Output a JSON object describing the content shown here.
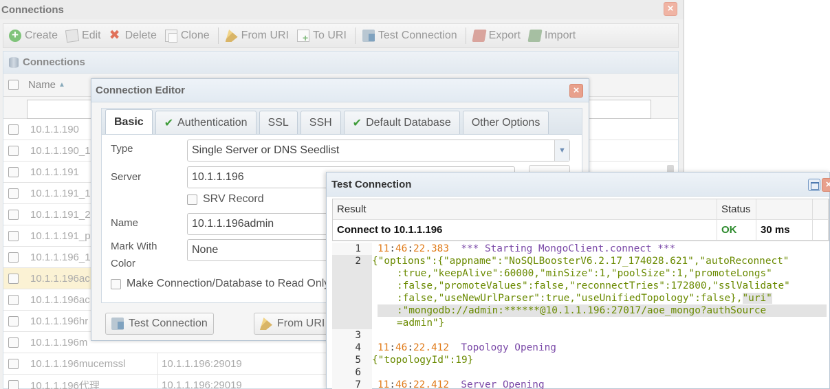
{
  "main_window": {
    "title": "Connections",
    "toolbar": {
      "create": "Create",
      "edit": "Edit",
      "delete": "Delete",
      "clone": "Clone",
      "from_uri": "From URI",
      "to_uri": "To URI",
      "test_connection": "Test Connection",
      "export": "Export",
      "import": "Import"
    },
    "panel_title": "Connections",
    "columns": {
      "name": "Name"
    },
    "rows": [
      {
        "name": "10.1.1.190",
        "server": ""
      },
      {
        "name": "10.1.1.190_1",
        "server": ""
      },
      {
        "name": "10.1.1.191",
        "server": ""
      },
      {
        "name": "10.1.1.191_1",
        "server": ""
      },
      {
        "name": "10.1.1.191_2",
        "server": ""
      },
      {
        "name": "10.1.1.191_p",
        "server": ""
      },
      {
        "name": "10.1.1.196_1",
        "server": ""
      },
      {
        "name": "10.1.1.196ac",
        "server": ""
      },
      {
        "name": "10.1.1.196ac",
        "server": ""
      },
      {
        "name": "10.1.1.196hr",
        "server": ""
      },
      {
        "name": "10.1.1.196m",
        "server": ""
      },
      {
        "name": "10.1.1.196mucemssl",
        "server": "10.1.1.196:29019"
      },
      {
        "name": "10.1.1.196代理",
        "server": "10.1.1.196:29019"
      }
    ]
  },
  "editor": {
    "title": "Connection Editor",
    "tabs": [
      "Basic",
      "Authentication",
      "SSL",
      "SSH",
      "Default Database",
      "Other Options"
    ],
    "type_label": "Type",
    "type_value": "Single Server or DNS Seedlist",
    "server_label": "Server",
    "server_value": "10.1.1.196",
    "srv_record": "SRV Record",
    "name_label": "Name",
    "name_value": "10.1.1.196admin",
    "mark_label_1": "Mark With",
    "mark_label_2": "Color",
    "mark_value": "None",
    "read_only": "Make Connection/Database to Read Only",
    "test_btn": "Test Connection",
    "from_uri_btn": "From URI"
  },
  "test_dialog": {
    "title": "Test Connection",
    "headers": {
      "result": "Result",
      "status": "Status"
    },
    "result": {
      "text": "Connect to 10.1.1.196",
      "status": "OK",
      "time": "30 ms"
    },
    "log": {
      "line1": {
        "time_h": "11",
        "time_m": "46",
        "time_s": "22.383",
        "msg": "*** Starting MongoClient.connect ***"
      },
      "line2_a": "{\"options\":{\"appname\":\"NoSQLBoosterV6.2.17_174028.621\",\"autoReconnect\"",
      "line2_b": ":true,\"keepAlive\":60000,\"minSize\":1,\"poolSize\":1,\"promoteLongs\"",
      "line2_c": ":false,\"promoteValues\":false,\"reconnectTries\":172800,\"sslValidate\"",
      "line2_d_main": ":false,\"useNewUrlParser\":true,\"useUnifiedTopology\":false},",
      "line2_d_sel": "\"uri\"",
      "line2_e": ":\"mongodb://admin:******@10.1.1.196:27017/aoe_mongo?authSource",
      "line2_f": "=admin\"}",
      "line4": {
        "time_h": "11",
        "time_m": "46",
        "time_s": "22.412",
        "msg": "Topology Opening"
      },
      "line5": "{\"topologyId\":19}",
      "line7": {
        "time_h": "11",
        "time_m": "46",
        "time_s": "22.412",
        "msg": "Server Opening"
      },
      "numbers": [
        "1",
        "2",
        "3",
        "4",
        "5",
        "6",
        "7"
      ]
    }
  }
}
